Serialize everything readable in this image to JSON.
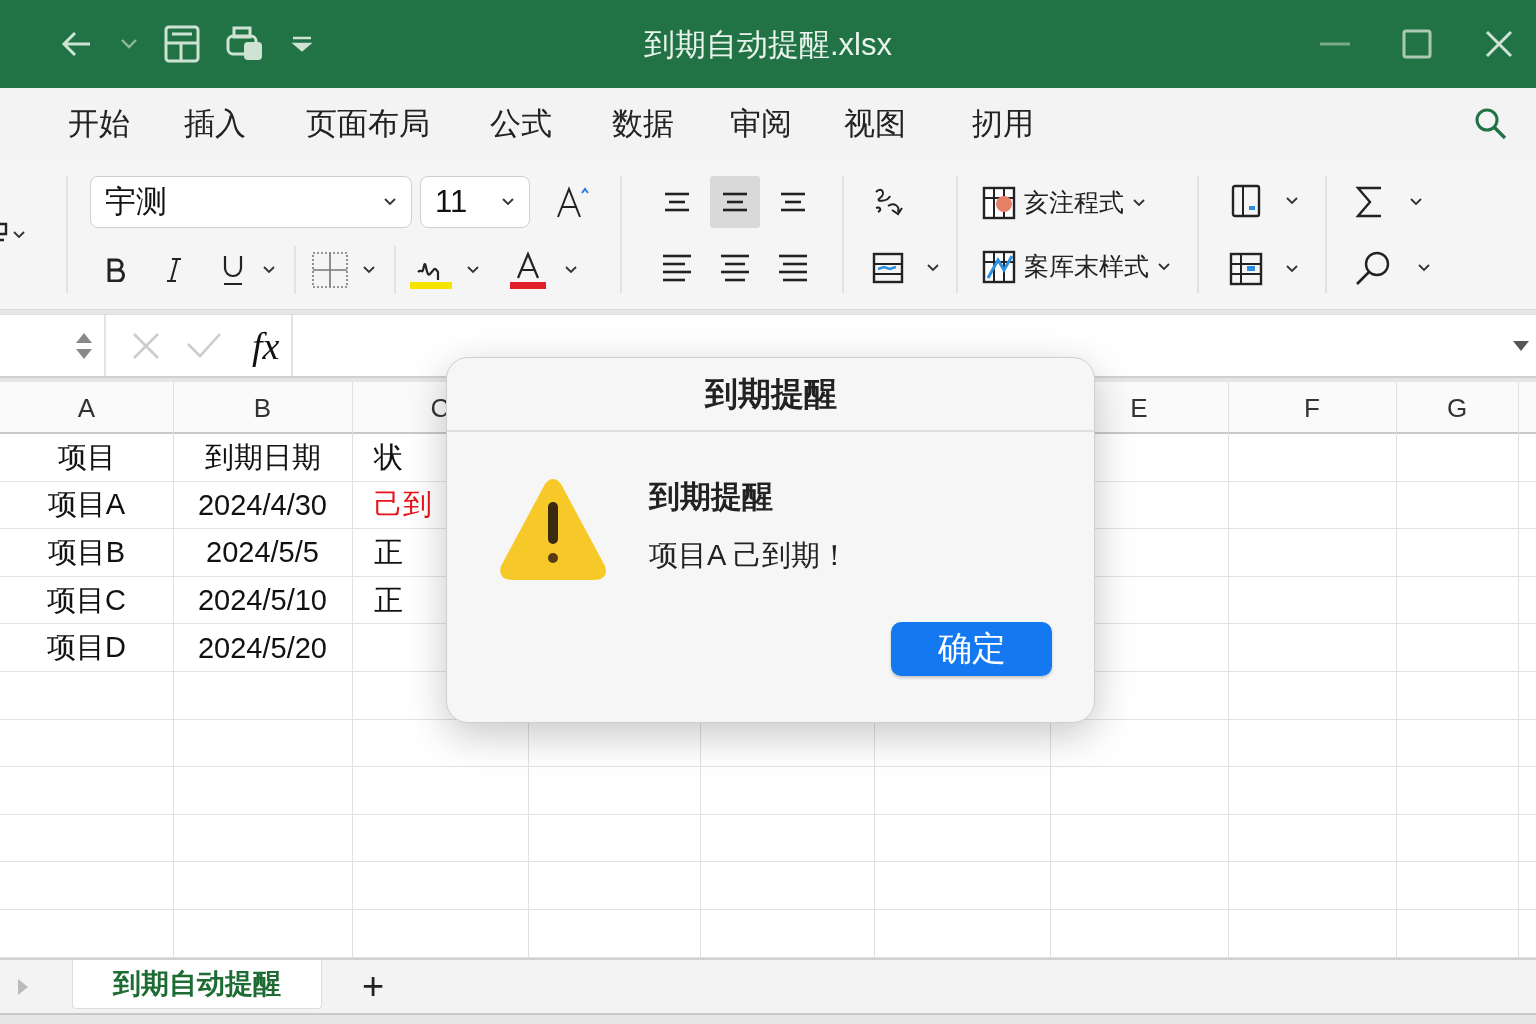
{
  "window": {
    "title": "到期自动提醒.xlsx"
  },
  "ribbon_tabs": [
    "开始",
    "插入",
    "页面布局",
    "公式",
    "数据",
    "审阅",
    "视图",
    "扨用"
  ],
  "ribbon": {
    "font": {
      "name": "宇测",
      "size": "11"
    },
    "alignment": [
      {
        "selected": false
      },
      {
        "selected": true
      },
      {
        "selected": false
      },
      {
        "selected": false
      },
      {
        "selected": false
      },
      {
        "selected": false
      }
    ],
    "styles": [
      "亥注程式",
      "案厍末样式"
    ]
  },
  "formula_bar": {
    "function_label": "fx"
  },
  "sheet": {
    "columns": [
      {
        "label": "A"
      },
      {
        "label": "B"
      },
      {
        "label": "C"
      },
      {},
      {},
      {},
      {
        "label": "E"
      },
      {
        "label": "F"
      },
      {
        "label": "G"
      },
      {}
    ],
    "rows": [
      {
        "cells": [
          "项目",
          "到期日期",
          "状"
        ],
        "overdue": false
      },
      {
        "cells": [
          "项目A",
          "2024/4/30",
          "己到"
        ],
        "overdue": true
      },
      {
        "cells": [
          "项目B",
          "2024/5/5",
          "正"
        ],
        "overdue": false
      },
      {
        "cells": [
          "项目C",
          "2024/5/10",
          "正"
        ],
        "overdue": false
      },
      {
        "cells": [
          "项目D",
          "2024/5/20"
        ]
      }
    ]
  },
  "sheet_tabs": [
    {
      "label": "到期自动提醒",
      "selected": true
    }
  ],
  "add_sheet": "+",
  "dialog": {
    "title": "到期提醒",
    "heading": "到期提醒",
    "message": "项目A 己到期！",
    "buttons": [
      "确定"
    ]
  }
}
